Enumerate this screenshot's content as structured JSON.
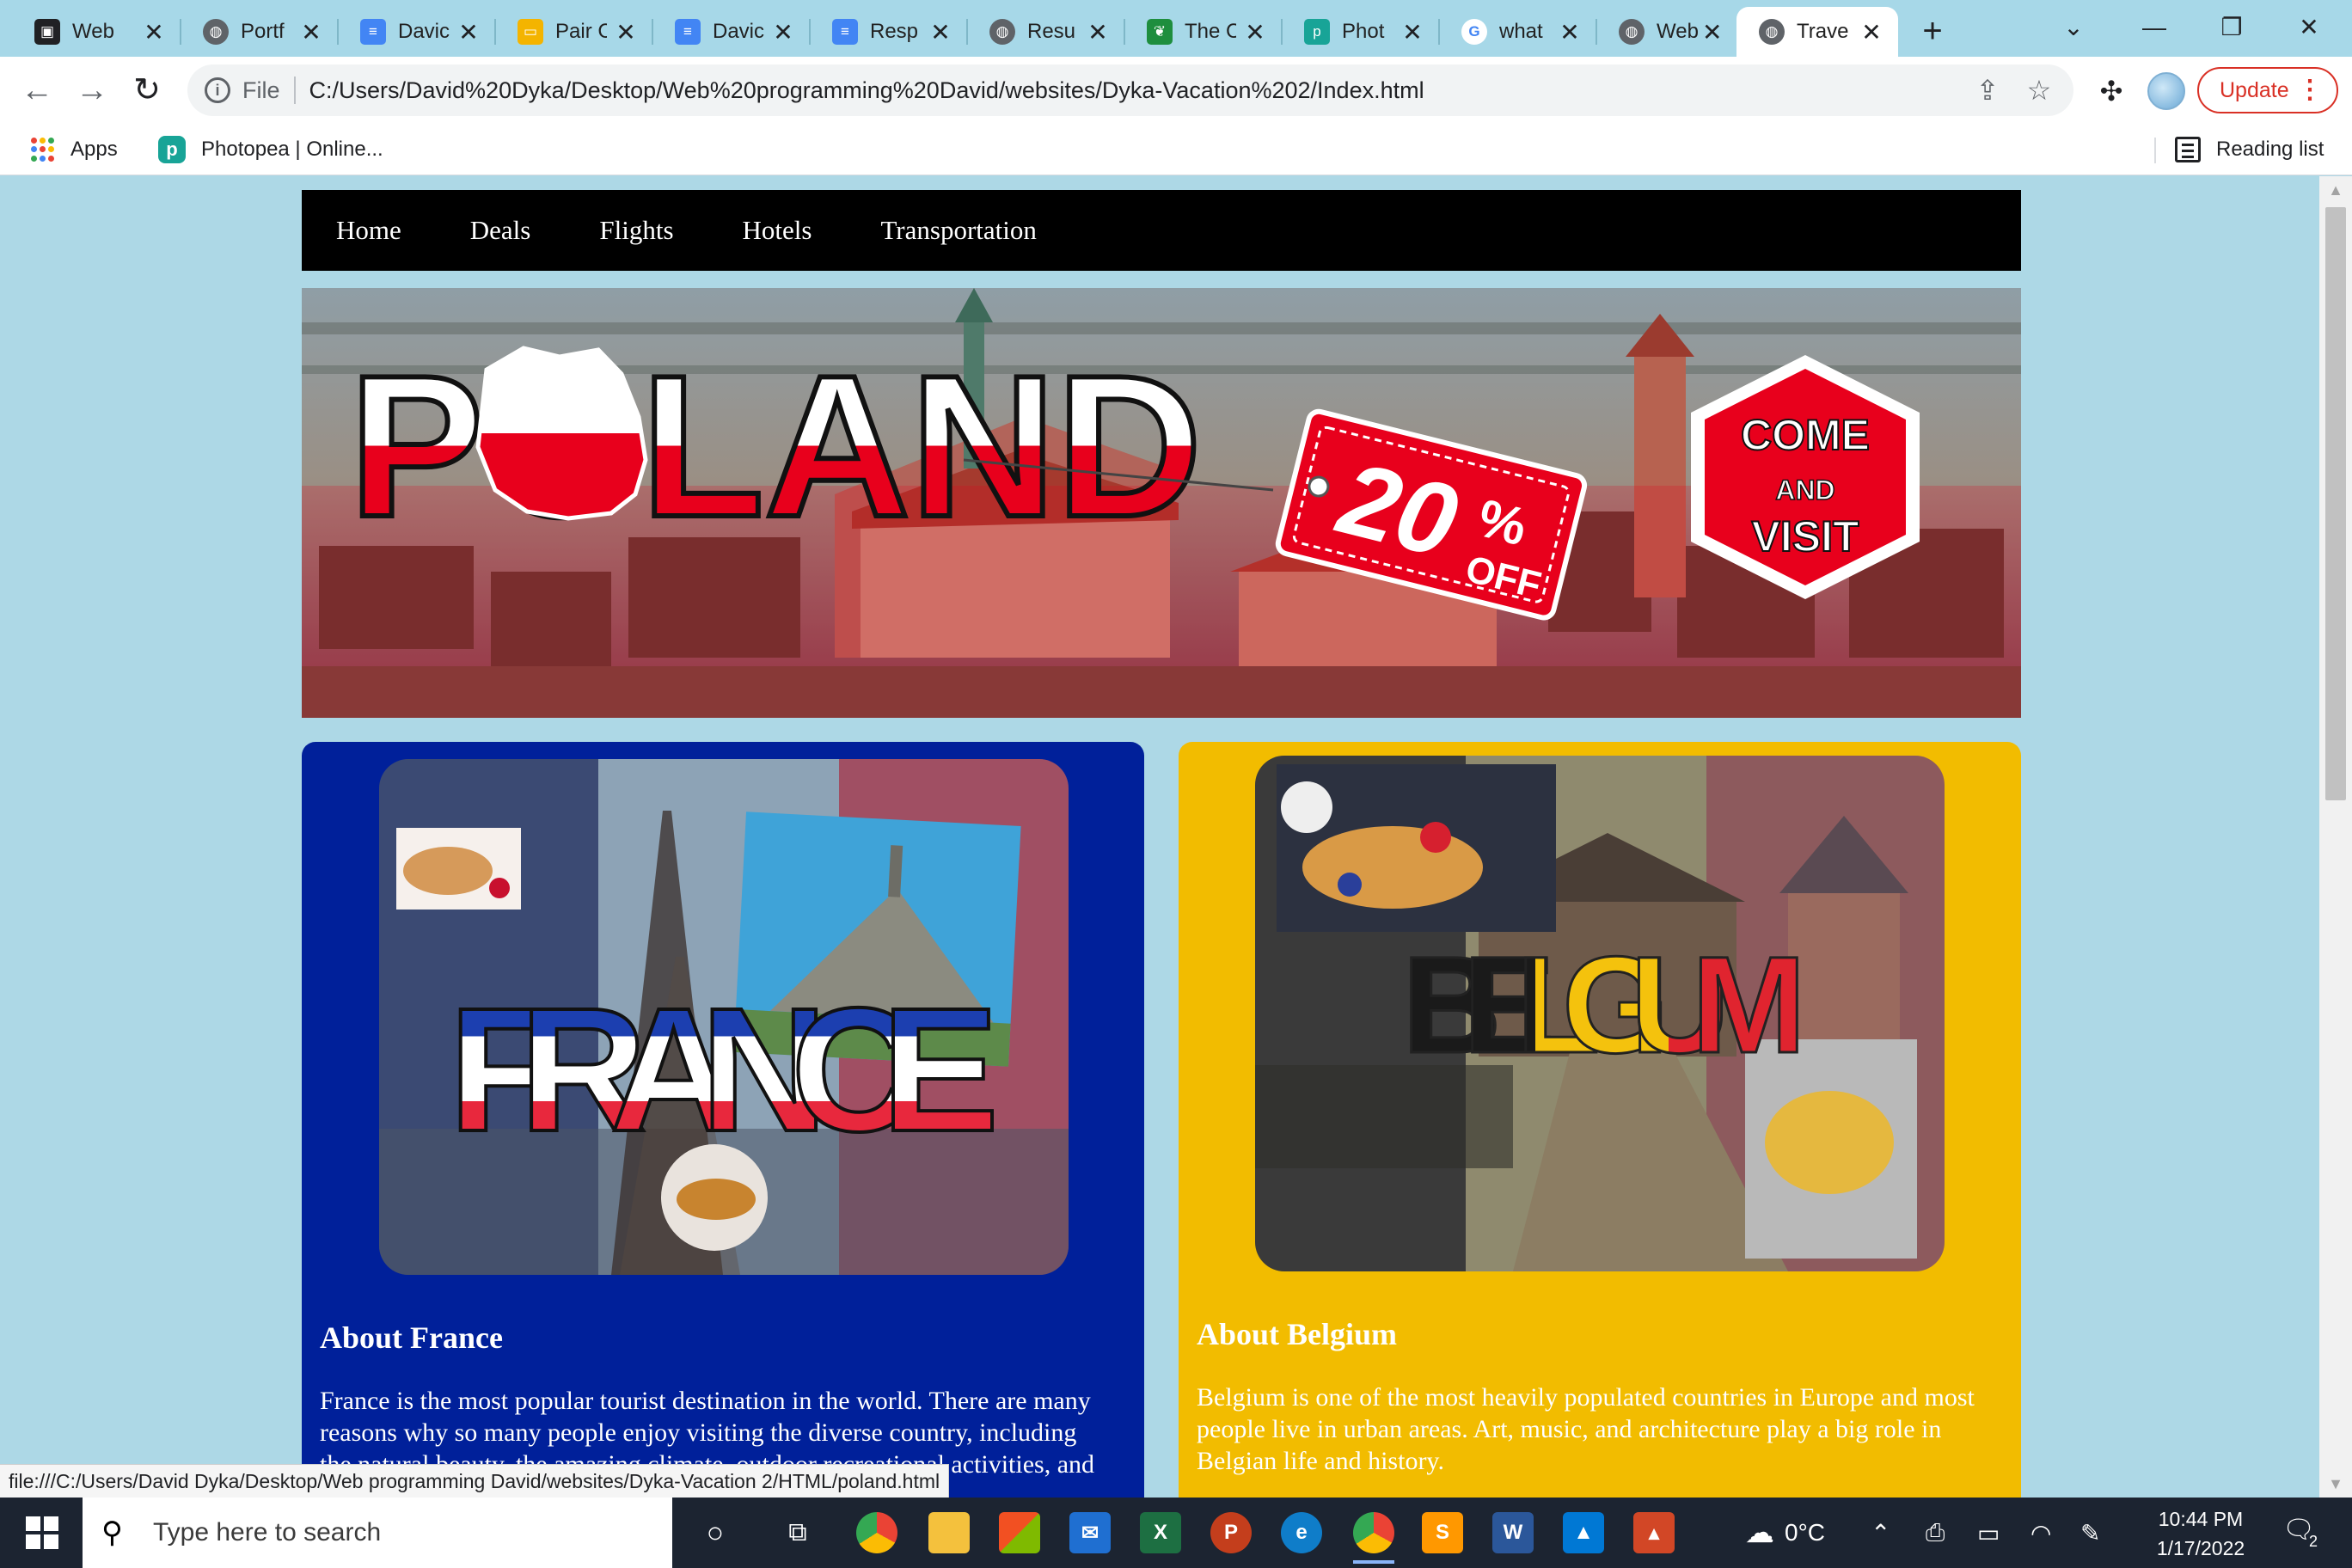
{
  "browser": {
    "tabs": [
      {
        "label": "Web",
        "icon": "contact-card-icon",
        "color": "#202124"
      },
      {
        "label": "Portf",
        "icon": "globe-icon",
        "color": "#5f6368"
      },
      {
        "label": "Davic",
        "icon": "google-docs-icon",
        "color": "#4285f4"
      },
      {
        "label": "Pair C",
        "icon": "google-slides-icon",
        "color": "#f4b400"
      },
      {
        "label": "Davic",
        "icon": "google-docs-icon",
        "color": "#4285f4"
      },
      {
        "label": "Resp",
        "icon": "google-docs-icon",
        "color": "#4285f4"
      },
      {
        "label": "Resu",
        "icon": "globe-icon",
        "color": "#5f6368"
      },
      {
        "label": "The C",
        "icon": "leaf-icon",
        "color": "#1e8e3e"
      },
      {
        "label": "Phot",
        "icon": "photopea-icon",
        "color": "#18a497"
      },
      {
        "label": "what",
        "icon": "google-icon",
        "color": "#ffffff"
      },
      {
        "label": "Web",
        "icon": "globe-icon",
        "color": "#5f6368"
      },
      {
        "label": "Trave",
        "icon": "globe-icon",
        "color": "#5f6368",
        "active": true
      }
    ],
    "url_scheme": "File",
    "url": "C:/Users/David%20Dyka/Desktop/Web%20programming%20David/websites/Dyka-Vacation%202/Index.html",
    "update_label": "Update",
    "bookmarks": {
      "apps": "Apps",
      "photopea": "Photopea | Online...",
      "reading_list": "Reading list"
    },
    "status_url": "file:///C:/Users/David Dyka/Desktop/Web programming David/websites/Dyka-Vacation 2/HTML/poland.html"
  },
  "site": {
    "nav": [
      "Home",
      "Deals",
      "Flights",
      "Hotels",
      "Transportation"
    ],
    "banner": {
      "title": "POLAND",
      "discount": "20",
      "percent": "%",
      "off": "OFF",
      "badge_line1": "COME",
      "badge_line2": "AND",
      "badge_line3": "VISIT"
    },
    "france": {
      "word": "FRANCE",
      "heading": "About France",
      "text": "France is the most popular tourist destination in the world. There are many reasons why so many people enjoy visiting the diverse country, including the natural beauty, the amazing climate, outdoor recreational activities, and so much"
    },
    "belgium": {
      "word": "BELGIUM",
      "heading": "About Belgium",
      "text": "Belgium is one of the most heavily populated countries in Europe and most people live in urban areas. Art, music, and architecture play a big role in Belgian life and history."
    }
  },
  "taskbar": {
    "search_placeholder": "Type here to search",
    "temperature": "0°C",
    "time": "10:44 PM",
    "date": "1/17/2022",
    "notification_count": "2"
  },
  "colors": {
    "page_bg": "#add8e6",
    "france_card": "#00209a",
    "belgium_card": "#f2bc00",
    "poland_red": "#e8001c",
    "update_red": "#d93025"
  }
}
